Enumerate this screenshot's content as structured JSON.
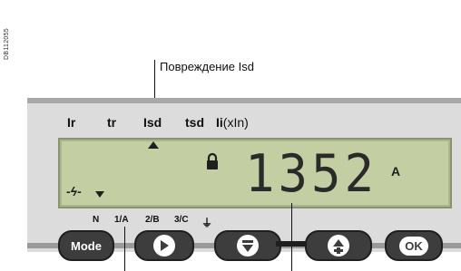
{
  "figure_code": "DB112055",
  "callout": "Повреждение Isd",
  "protection_labels": {
    "ir": "Ir",
    "tr": "tr",
    "isd": "Isd",
    "tsd": "tsd",
    "ii": "Ii",
    "ii_suffix": "(xIn)"
  },
  "display": {
    "value": "1352",
    "unit": "A",
    "fault_symbol": "-ϟ-"
  },
  "phases": {
    "n": "N",
    "p1": "1/A",
    "p2": "2/B",
    "p3": "3/C",
    "ground": "⏚"
  },
  "buttons": {
    "mode": "Mode",
    "ok": "OK"
  }
}
